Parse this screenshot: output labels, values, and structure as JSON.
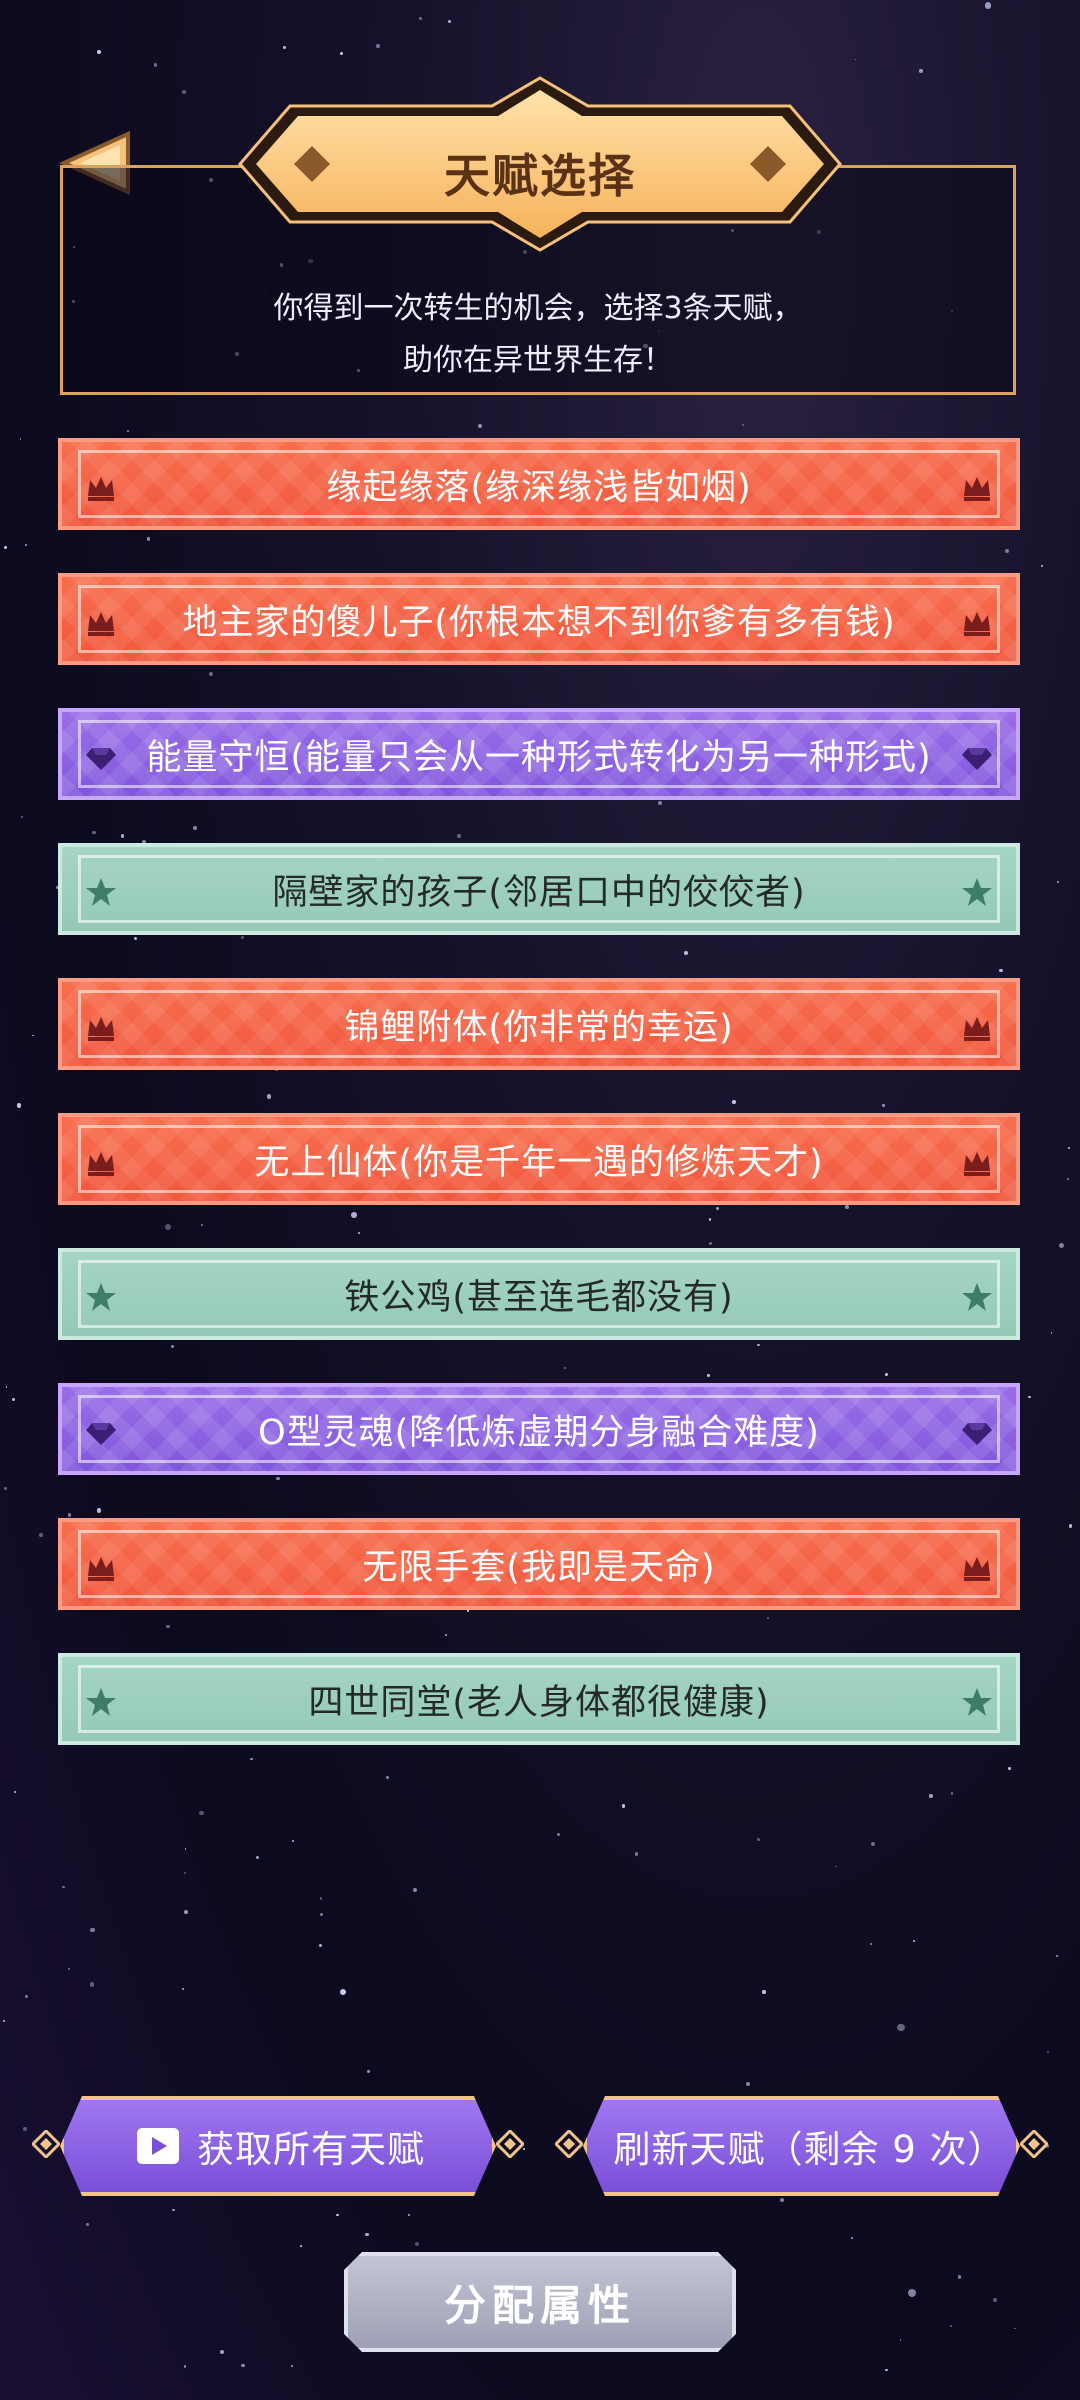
{
  "header": {
    "title": "天赋选择",
    "info_line1": "你得到一次转生的机会，选择3条天赋，",
    "info_line2": "助你在异世界生存！"
  },
  "talents": [
    {
      "label": "缘起缘落(缘深缘浅皆如烟)",
      "tier": "orange",
      "icon": "crown-icon"
    },
    {
      "label": "地主家的傻儿子(你根本想不到你爹有多有钱)",
      "tier": "orange",
      "icon": "crown-icon"
    },
    {
      "label": "能量守恒(能量只会从一种形式转化为另一种形式)",
      "tier": "purple",
      "icon": "gem-icon"
    },
    {
      "label": "隔壁家的孩子(邻居口中的佼佼者)",
      "tier": "green",
      "icon": "star-icon"
    },
    {
      "label": "锦鲤附体(你非常的幸运)",
      "tier": "orange",
      "icon": "crown-icon"
    },
    {
      "label": "无上仙体(你是千年一遇的修炼天才)",
      "tier": "orange",
      "icon": "crown-icon"
    },
    {
      "label": "铁公鸡(甚至连毛都没有)",
      "tier": "green",
      "icon": "star-icon"
    },
    {
      "label": "O型灵魂(降低炼虚期分身融合难度)",
      "tier": "purple",
      "icon": "gem-icon"
    },
    {
      "label": "无限手套(我即是天命)",
      "tier": "orange",
      "icon": "crown-icon"
    },
    {
      "label": "四世同堂(老人身体都很健康)",
      "tier": "green",
      "icon": "star-icon"
    }
  ],
  "buttons": {
    "get_all": "获取所有天赋",
    "refresh": "刷新天赋（剩余 9 次）",
    "assign": "分配属性"
  },
  "colors": {
    "orange": "#f1573d",
    "purple": "#8156dd",
    "green": "#95c9b6",
    "gold": "#f6c27a"
  }
}
